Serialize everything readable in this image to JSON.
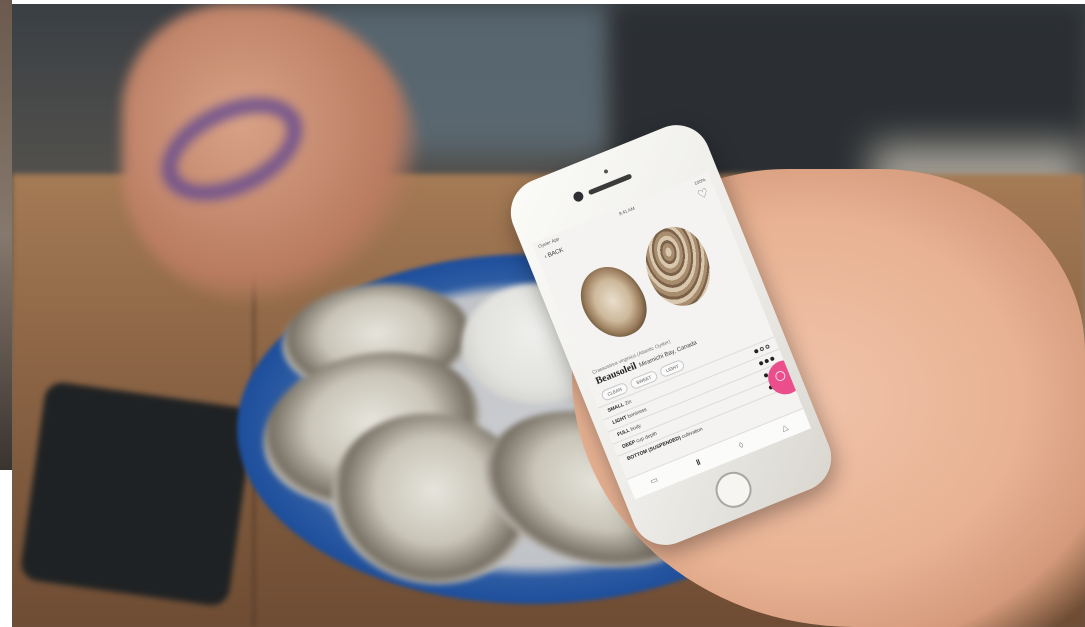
{
  "status_bar": {
    "carrier": "Oyster App",
    "time": "9:41 AM",
    "battery": "100%"
  },
  "nav": {
    "back_label": "‹ BACK",
    "favorite_icon": "heart-icon"
  },
  "oyster": {
    "species": "Crassostrea virginica (Atlantic Oyster)",
    "name": "Beausoleil",
    "origin": "Miramichi Bay, Canada",
    "tags": [
      "CLEAN",
      "SWEET",
      "LIGHT"
    ]
  },
  "attributes": [
    {
      "level": "SMALL",
      "detail": "2in",
      "filled": 1,
      "total": 3
    },
    {
      "level": "LIGHT",
      "detail": "brininess",
      "filled": 3,
      "total": 3
    },
    {
      "level": "FULL",
      "detail": "body",
      "filled": 3,
      "total": 3
    },
    {
      "level": "DEEP",
      "detail": "cup depth",
      "filled": 3,
      "total": 3
    },
    {
      "level": "BOTTOM (SUSPENDED)",
      "detail": "cultivation",
      "filled": 0,
      "total": 0
    }
  ],
  "tab_bar": {
    "tabs": [
      {
        "icon": "list-icon",
        "glyph": "▭"
      },
      {
        "icon": "pause-icon",
        "glyph": "‖"
      },
      {
        "icon": "drop-icon",
        "glyph": "◊"
      },
      {
        "icon": "alert-icon",
        "glyph": "△"
      }
    ],
    "active_index": 1
  },
  "colors": {
    "accent": "#ea4e8b",
    "plate_rim": "#1e4f9c"
  }
}
